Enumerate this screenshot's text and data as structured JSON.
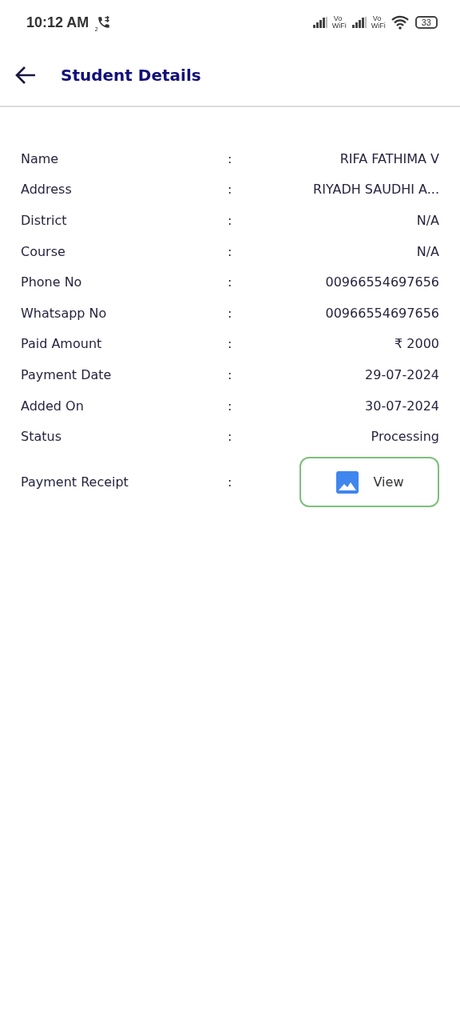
{
  "status_bar": {
    "time": "10:12 AM",
    "call_sim": "2",
    "vowifi": [
      {
        "top": "Vo",
        "bottom": "WiFi"
      },
      {
        "top": "Vo",
        "bottom": "WiFi"
      }
    ],
    "battery": "33"
  },
  "header": {
    "title": "Student Details"
  },
  "details": [
    {
      "label": "Name",
      "separator": ":",
      "value": "RIFA FATHIMA V"
    },
    {
      "label": "Address",
      "separator": ":",
      "value": "RIYADH SAUDHI A..."
    },
    {
      "label": "District",
      "separator": ":",
      "value": "N/A"
    },
    {
      "label": "Course",
      "separator": ":",
      "value": "N/A"
    },
    {
      "label": "Phone No",
      "separator": ":",
      "value": "00966554697656"
    },
    {
      "label": "Whatsapp No",
      "separator": ":",
      "value": "00966554697656"
    },
    {
      "label": "Paid Amount",
      "separator": ":",
      "value": "₹ 2000"
    },
    {
      "label": "Payment Date",
      "separator": ":",
      "value": "29-07-2024"
    },
    {
      "label": "Added On",
      "separator": ":",
      "value": "30-07-2024"
    },
    {
      "label": "Status",
      "separator": ":",
      "value": "Processing"
    }
  ],
  "receipt": {
    "label": "Payment Receipt",
    "separator": ":",
    "button": "View"
  }
}
